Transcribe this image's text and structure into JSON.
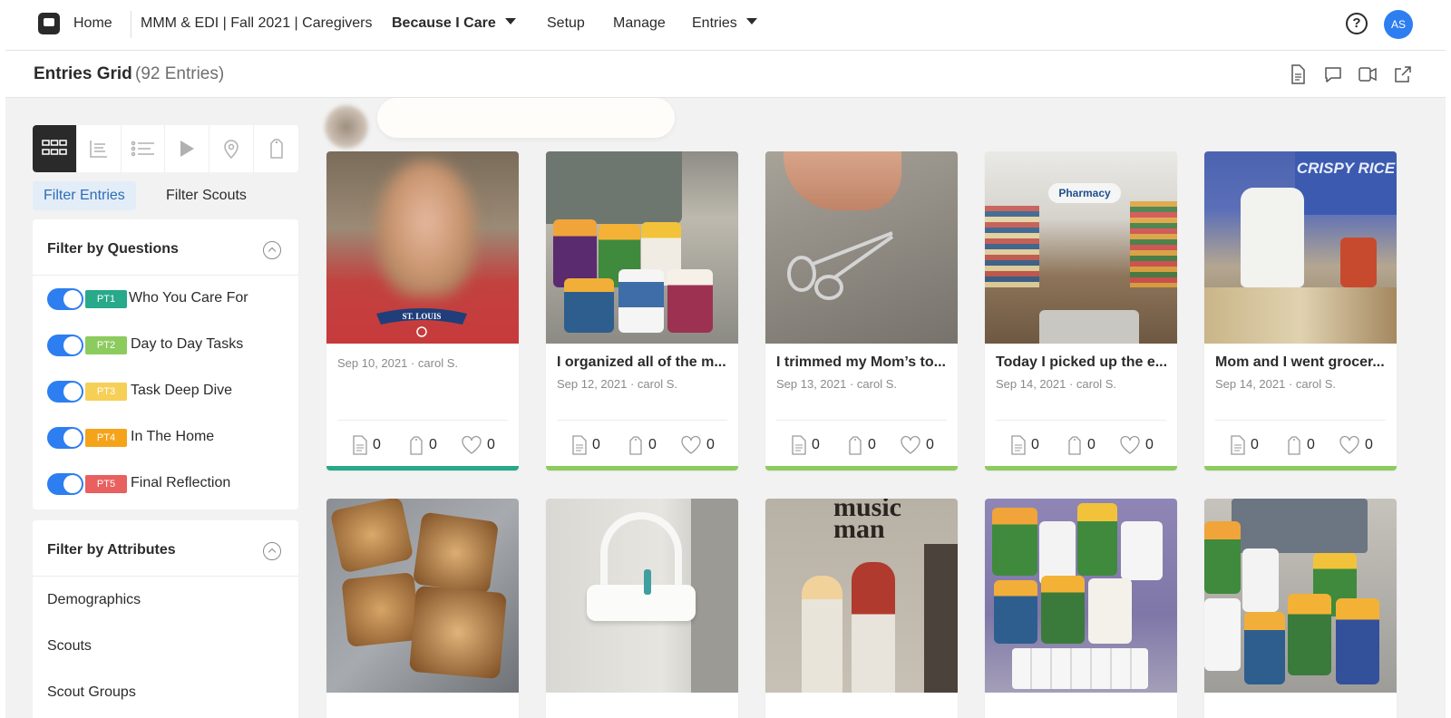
{
  "nav": {
    "home": "Home",
    "project": "MMM & EDI | Fall 2021 | Caregivers",
    "study": "Because I Care",
    "setup": "Setup",
    "manage": "Manage",
    "entries": "Entries",
    "help_glyph": "?",
    "avatar_initials": "AS"
  },
  "header": {
    "title": "Entries Grid",
    "count": "(92 Entries)"
  },
  "sidebar": {
    "view_modes": [
      "grid-view",
      "gallery-view",
      "list-view",
      "video-view",
      "map-view",
      "tag-view"
    ],
    "filter_tabs": [
      "Filter Entries",
      "Filter Scouts"
    ],
    "questions_title": "Filter by Questions",
    "questions": [
      {
        "badge": "PT1",
        "label": "Who You Care For",
        "color": "#27a98a"
      },
      {
        "badge": "PT2",
        "label": "Day to Day Tasks",
        "color": "#8ccb5e"
      },
      {
        "badge": "PT3",
        "label": "Task Deep Dive",
        "color": "#f6cf57"
      },
      {
        "badge": "PT4",
        "label": "In The Home",
        "color": "#f5a31a"
      },
      {
        "badge": "PT5",
        "label": "Final Reflection",
        "color": "#e8605f"
      }
    ],
    "attributes_title": "Filter by Attributes",
    "attributes": [
      "Demographics",
      "Scouts",
      "Scout Groups"
    ]
  },
  "cards_row1": [
    {
      "title": "",
      "meta": "Sep 10, 2021 · carol S.",
      "comments": "0",
      "tags": "0",
      "likes": "0",
      "bar": "#27a98a"
    },
    {
      "title": "I organized all of the m...",
      "meta": "Sep 12, 2021 · carol S.",
      "comments": "0",
      "tags": "0",
      "likes": "0",
      "bar": "#8ccb5e"
    },
    {
      "title": "I trimmed my Mom’s to...",
      "meta": "Sep 13, 2021 · carol S.",
      "comments": "0",
      "tags": "0",
      "likes": "0",
      "bar": "#8ccb5e"
    },
    {
      "title": "Today I picked up the e...",
      "meta": "Sep 14, 2021 · carol S.",
      "comments": "0",
      "tags": "0",
      "likes": "0",
      "bar": "#8ccb5e"
    },
    {
      "title": "Mom and I went grocer...",
      "meta": "Sep 14, 2021 · carol S.",
      "comments": "0",
      "tags": "0",
      "likes": "0",
      "bar": "#8ccb5e"
    }
  ],
  "photo_text": {
    "pharmacy_sign": "Pharmacy",
    "cereal_box": "CRISPY RICE",
    "shirt": "ST. LOUIS",
    "poster": "music man"
  }
}
